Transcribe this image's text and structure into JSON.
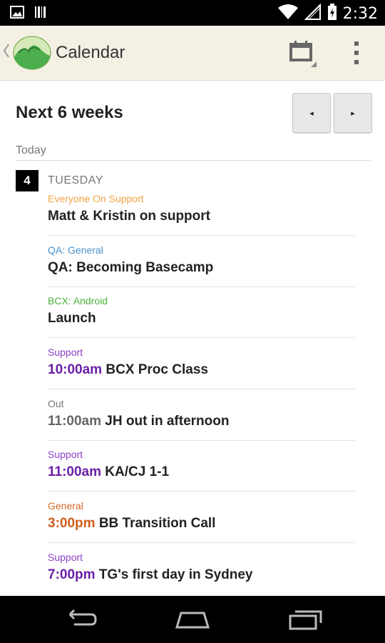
{
  "statusbar": {
    "time": "2:32"
  },
  "actionbar": {
    "title": "Calendar"
  },
  "header": {
    "title": "Next 6 weeks",
    "prev_label": "◂",
    "next_label": "▸"
  },
  "today_label": "Today",
  "day": {
    "number": "4",
    "name": "TUESDAY"
  },
  "events": [
    {
      "category": "Everyone On Support",
      "category_color": "#f0a244",
      "time": "",
      "time_color": "",
      "title": "Matt & Kristin on support"
    },
    {
      "category": "QA: General",
      "category_color": "#4a90c9",
      "time": "",
      "time_color": "",
      "title": "QA: Becoming Basecamp"
    },
    {
      "category": "BCX: Android",
      "category_color": "#4caf3c",
      "time": "",
      "time_color": "",
      "title": "Launch"
    },
    {
      "category": "Support",
      "category_color": "#8a3fc6",
      "time": "10:00am",
      "time_color": "#6a1fa8",
      "title": "BCX Proc Class"
    },
    {
      "category": "Out",
      "category_color": "#777777",
      "time": "11:00am",
      "time_color": "#666666",
      "title": "JH out in afternoon"
    },
    {
      "category": "Support",
      "category_color": "#8a3fc6",
      "time": "11:00am",
      "time_color": "#6a1fa8",
      "title": "KA/CJ 1-1"
    },
    {
      "category": "General",
      "category_color": "#d4692a",
      "time": "3:00pm",
      "time_color": "#d05e1e",
      "title": "BB Transition Call"
    },
    {
      "category": "Support",
      "category_color": "#8a3fc6",
      "time": "7:00pm",
      "time_color": "#6a1fa8",
      "title": "TG's first day in Sydney"
    }
  ],
  "icons": {
    "status_left": [
      "image-icon",
      "barcode-icon"
    ],
    "status_right": [
      "wifi-icon",
      "signal-icon",
      "battery-icon"
    ],
    "actionbar": [
      "back-chevron-icon",
      "basecamp-logo-icon",
      "calendar-icon",
      "overflow-menu-icon"
    ],
    "navbar": [
      "back-icon",
      "home-icon",
      "recents-icon"
    ]
  }
}
